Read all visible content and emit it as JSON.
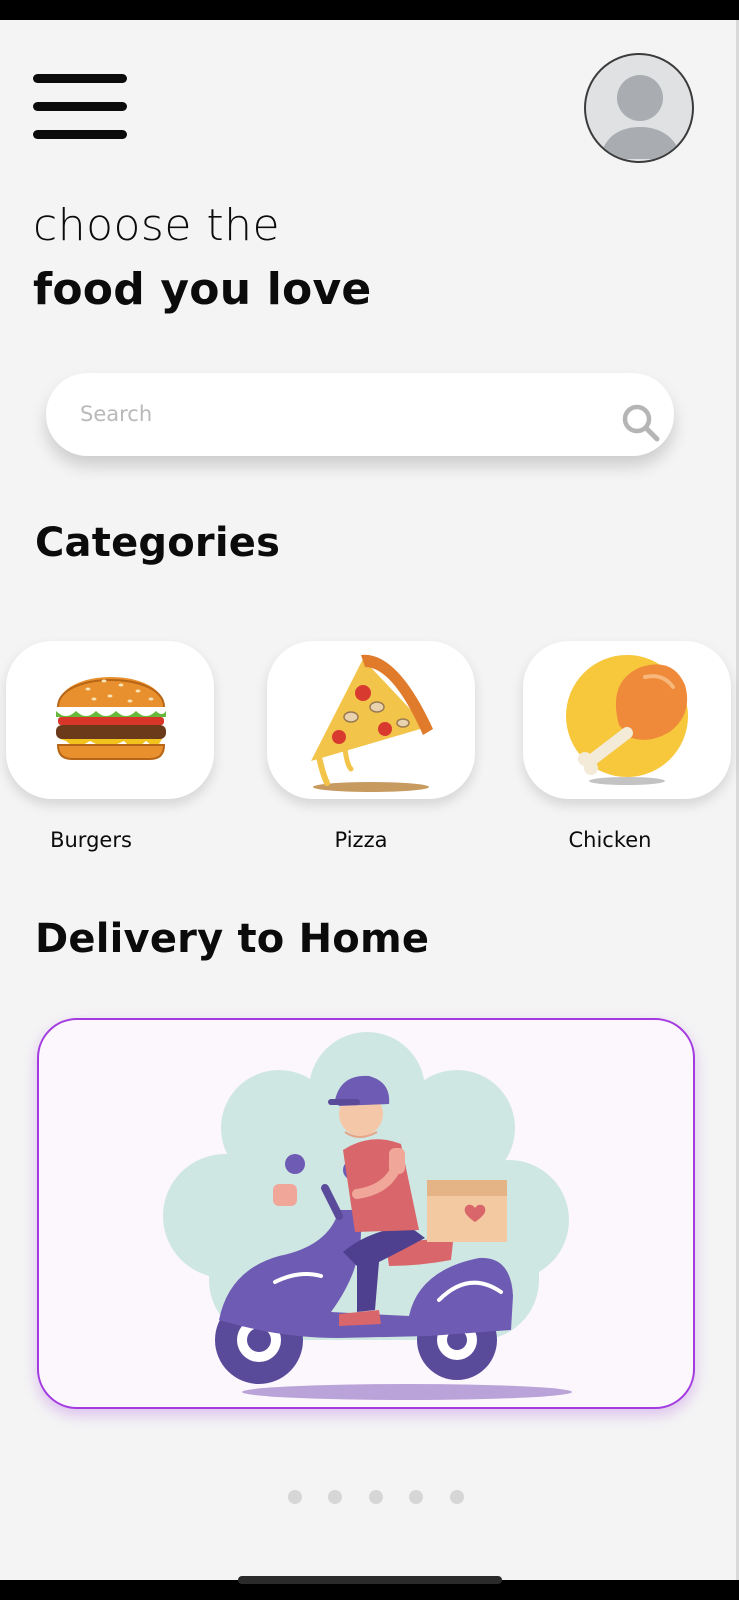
{
  "headline": {
    "line1": "choose the",
    "line2": "food you love"
  },
  "search": {
    "placeholder": "Search",
    "icon": "search-icon"
  },
  "menu": {
    "icon": "hamburger-menu-icon"
  },
  "profile": {
    "icon": "user-avatar-icon"
  },
  "categories": {
    "title": "Categories",
    "items": [
      {
        "label": "Burgers",
        "icon": "burger-icon"
      },
      {
        "label": "Pizza",
        "icon": "pizza-slice-icon"
      },
      {
        "label": "Chicken",
        "icon": "chicken-leg-icon"
      }
    ]
  },
  "delivery": {
    "title": "Delivery to Home",
    "image": "delivery-scooter-illustration"
  },
  "carousel": {
    "dot_count": 5
  },
  "colors": {
    "background": "#f4f4f4",
    "accent_border": "#a33be0",
    "text": "#0b0b0b",
    "scooter": "#6e5bb3",
    "bubble": "#cfe7e2"
  }
}
